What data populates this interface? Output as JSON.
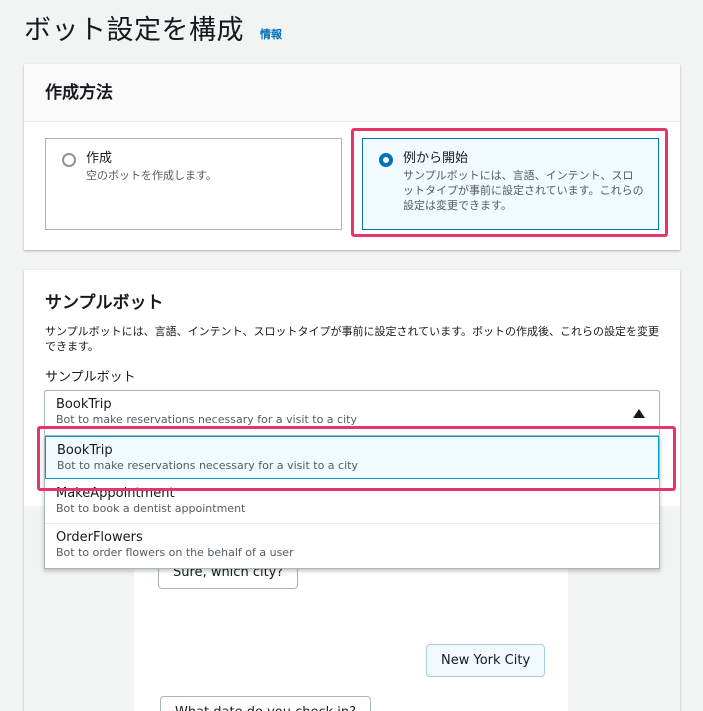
{
  "page": {
    "title": "ボット設定を構成",
    "info_link": "情報"
  },
  "creation_method": {
    "header": "作成方法",
    "options": [
      {
        "title": "作成",
        "description": "空のボットを作成します。",
        "selected": false
      },
      {
        "title": "例から開始",
        "description": "サンプルボットには、言語、インテント、スロットタイプが事前に設定されています。これらの設定は変更できます。",
        "selected": true
      }
    ]
  },
  "sample_bot": {
    "title": "サンプルボット",
    "description": "サンプルボットには、言語、インテント、スロットタイプが事前に設定されています。ボットの作成後、これらの設定を変更できます。",
    "field_label": "サンプルボット",
    "selected": {
      "title": "BookTrip",
      "description": "Bot to make reservations necessary for a visit to a city"
    },
    "options": [
      {
        "title": "BookTrip",
        "description": "Bot to make reservations necessary for a visit to a city"
      },
      {
        "title": "MakeAppointment",
        "description": "Bot to book a dentist appointment"
      },
      {
        "title": "OrderFlowers",
        "description": "Bot to order flowers on the behalf of a user"
      }
    ]
  },
  "chat_preview": {
    "bot_message_1": "Sure, which city?",
    "user_message_1": "New York City",
    "bot_message_2": "What date do you check in?"
  },
  "colors": {
    "accent": "#0073bb",
    "highlight": "#e8336b",
    "selected_bg": "#f1faff"
  }
}
